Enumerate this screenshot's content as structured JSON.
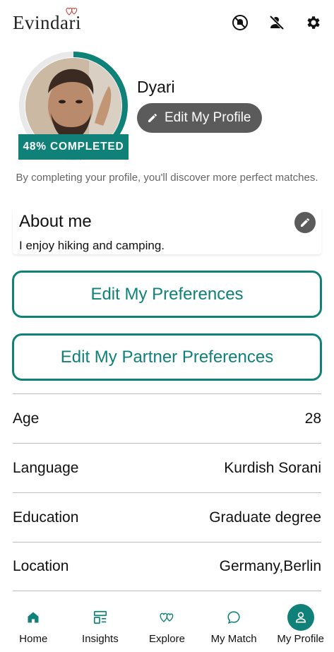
{
  "app": {
    "logo_text": "Evindari"
  },
  "header": {
    "icons": [
      "no-bell-icon",
      "block-user-icon",
      "gear-icon"
    ]
  },
  "profile": {
    "name": "Dyari",
    "completion_percent": 48,
    "completion_text": "48% COMPLETED",
    "edit_profile_label": "Edit My Profile",
    "hint": "By completing your profile, you'll discover more perfect matches."
  },
  "about": {
    "title": "About me",
    "text": "I enjoy hiking and camping."
  },
  "buttons": {
    "preferences": "Edit My Preferences",
    "partner_preferences": "Edit My Partner Preferences"
  },
  "info": [
    {
      "label": "Age",
      "value": "28"
    },
    {
      "label": "Language",
      "value": "Kurdish Sorani"
    },
    {
      "label": "Education",
      "value": "Graduate degree"
    },
    {
      "label": "Location",
      "value": "Germany,Berlin"
    }
  ],
  "nav": [
    {
      "label": "Home",
      "icon": "home-icon"
    },
    {
      "label": "Insights",
      "icon": "insights-icon"
    },
    {
      "label": "Explore",
      "icon": "hearts-icon"
    },
    {
      "label": "My Match",
      "icon": "chat-icon"
    },
    {
      "label": "My Profile",
      "icon": "user-icon",
      "active": true
    }
  ],
  "colors": {
    "accent": "#0f8178",
    "dark_button": "#5b5b5b",
    "divider": "#bdbdbd"
  }
}
